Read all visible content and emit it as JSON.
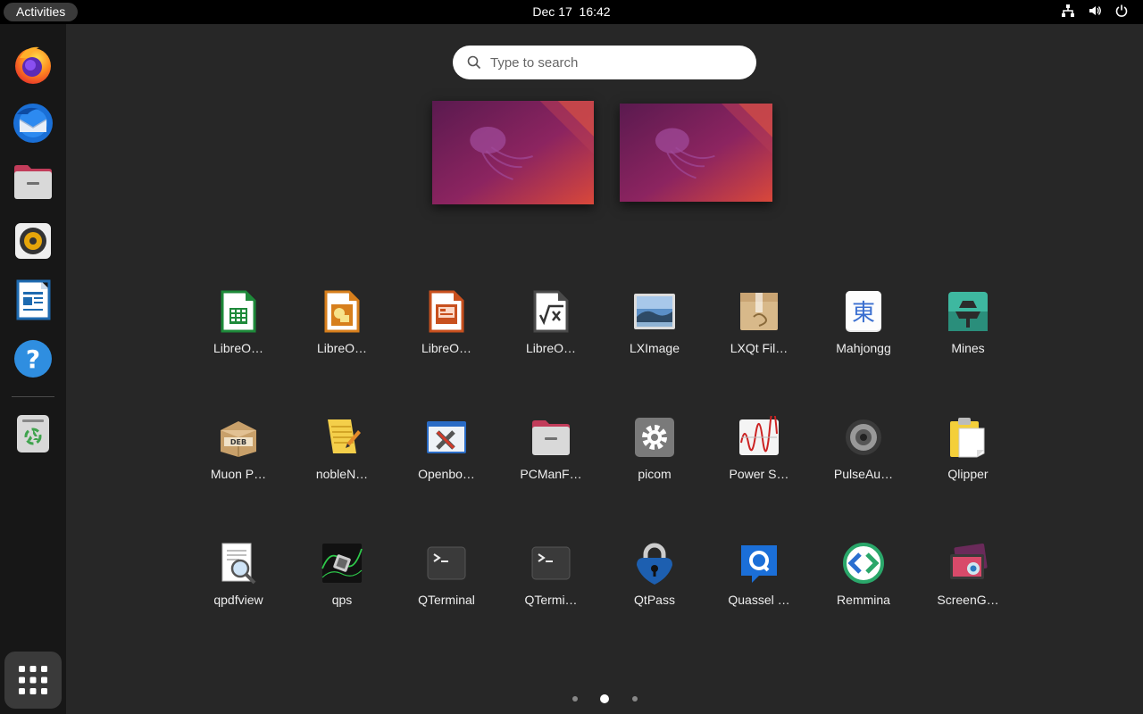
{
  "topbar": {
    "activities_label": "Activities",
    "date": "Dec 17",
    "time": "16:42",
    "tray_icons": [
      "network-icon",
      "volume-icon",
      "power-icon"
    ]
  },
  "dock": {
    "items": [
      {
        "name": "firefox",
        "icon": "firefox-icon"
      },
      {
        "name": "thunderbird",
        "icon": "thunderbird-icon"
      },
      {
        "name": "files",
        "icon": "folder-icon"
      },
      {
        "name": "rhythmbox",
        "icon": "speaker-icon"
      },
      {
        "name": "libreoffice-writer",
        "icon": "document-icon"
      },
      {
        "name": "help",
        "icon": "help-icon"
      },
      {
        "name": "trash",
        "icon": "trash-icon"
      }
    ],
    "show_apps_icon": "grid-icon"
  },
  "search": {
    "placeholder": "Type to search"
  },
  "workspaces": [
    {
      "name": "workspace-1"
    },
    {
      "name": "workspace-2"
    }
  ],
  "apps": [
    {
      "label": "LibreO…",
      "icon": "spreadsheet-icon"
    },
    {
      "label": "LibreO…",
      "icon": "drawing-icon"
    },
    {
      "label": "LibreO…",
      "icon": "presentation-icon"
    },
    {
      "label": "LibreO…",
      "icon": "formula-icon"
    },
    {
      "label": "LXImage",
      "icon": "image-viewer-icon"
    },
    {
      "label": "LXQt Fil…",
      "icon": "archive-icon"
    },
    {
      "label": "Mahjongg",
      "icon": "mahjongg-icon"
    },
    {
      "label": "Mines",
      "icon": "mines-icon"
    },
    {
      "label": "Muon P…",
      "icon": "deb-package-icon"
    },
    {
      "label": "nobleN…",
      "icon": "notepad-icon"
    },
    {
      "label": "Openbo…",
      "icon": "settings-tools-icon"
    },
    {
      "label": "PCManF…",
      "icon": "folder-icon"
    },
    {
      "label": "picom",
      "icon": "gear-icon"
    },
    {
      "label": "Power S…",
      "icon": "power-stats-icon"
    },
    {
      "label": "PulseAu…",
      "icon": "speaker-icon"
    },
    {
      "label": "Qlipper",
      "icon": "clipboard-icon"
    },
    {
      "label": "qpdfview",
      "icon": "pdf-viewer-icon"
    },
    {
      "label": "qps",
      "icon": "process-icon"
    },
    {
      "label": "QTerminal",
      "icon": "terminal-icon"
    },
    {
      "label": "QTermi…",
      "icon": "terminal-icon"
    },
    {
      "label": "QtPass",
      "icon": "lock-icon"
    },
    {
      "label": "Quassel …",
      "icon": "chat-icon"
    },
    {
      "label": "Remmina",
      "icon": "remote-desktop-icon"
    },
    {
      "label": "ScreenG…",
      "icon": "screenshot-icon"
    }
  ],
  "pagination": {
    "pages": 3,
    "current": 2
  },
  "colors": {
    "background": "#272727",
    "topbar": "#000000",
    "dock": "#171717",
    "accent_wallpaper": "#7a1f5c"
  }
}
